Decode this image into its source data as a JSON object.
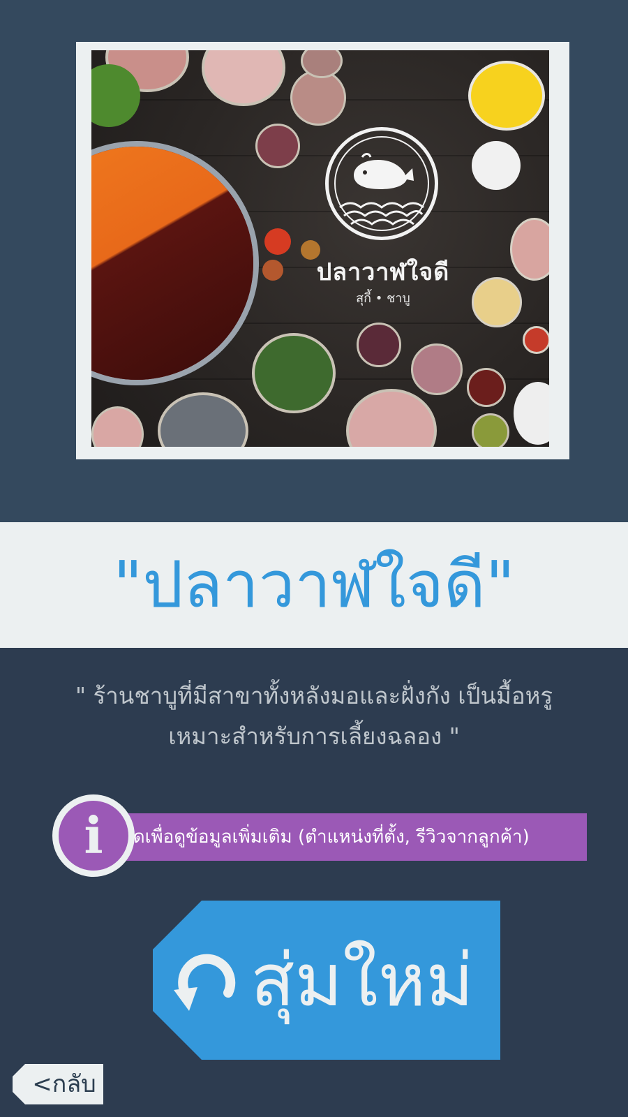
{
  "restaurant": {
    "image_logo_title": "ปลาวาฬใจดี",
    "image_logo_subtitle": "สุกี้ • ชาบู",
    "name": "\"ปลาวาฬใจดี\"",
    "description": "\" ร้านชาบูที่มีสาขาทั้งหลังมอและฝั่งกัง  เป็นมื้อหรู เหมาะสำหรับการเลี้ยงฉลอง  \""
  },
  "info": {
    "label": "กดเพื่อดูข้อมูลเพิ่มเติม (ตำแหน่งที่ตั้ง, รีวิวจากลูกค้า)",
    "icon": "info-icon",
    "icon_glyph": "i"
  },
  "actions": {
    "random_label": "สุ่มใหม่",
    "random_icon": "refresh-icon",
    "back_label": "<กลับ"
  },
  "colors": {
    "background_top": "#34495e",
    "background_bottom": "#2d3c50",
    "light": "#ecf0f1",
    "accent_blue": "#3498db",
    "accent_purple": "#9b59b6",
    "muted_text": "#bfc6cc"
  }
}
